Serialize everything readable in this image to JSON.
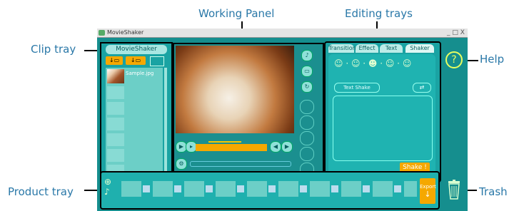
{
  "callouts": {
    "working_panel": "Working Panel",
    "editing_trays": "Editing trays",
    "clip_tray": "Clip tray",
    "help": "Help",
    "product_tray": "Product tray",
    "trash": "Trash"
  },
  "window": {
    "title": "MovieShaker",
    "controls": "_ □ X"
  },
  "clip_tray": {
    "header": "MovieShaker",
    "clip_name": "Sample.jpg"
  },
  "editing": {
    "tabs": [
      "Transition",
      "Effect",
      "Text",
      "Shaker"
    ],
    "text_field": "Text Shake",
    "shake_button": "Shake !"
  },
  "product_tray": {
    "export_label": "Export"
  },
  "help_symbol": "?"
}
